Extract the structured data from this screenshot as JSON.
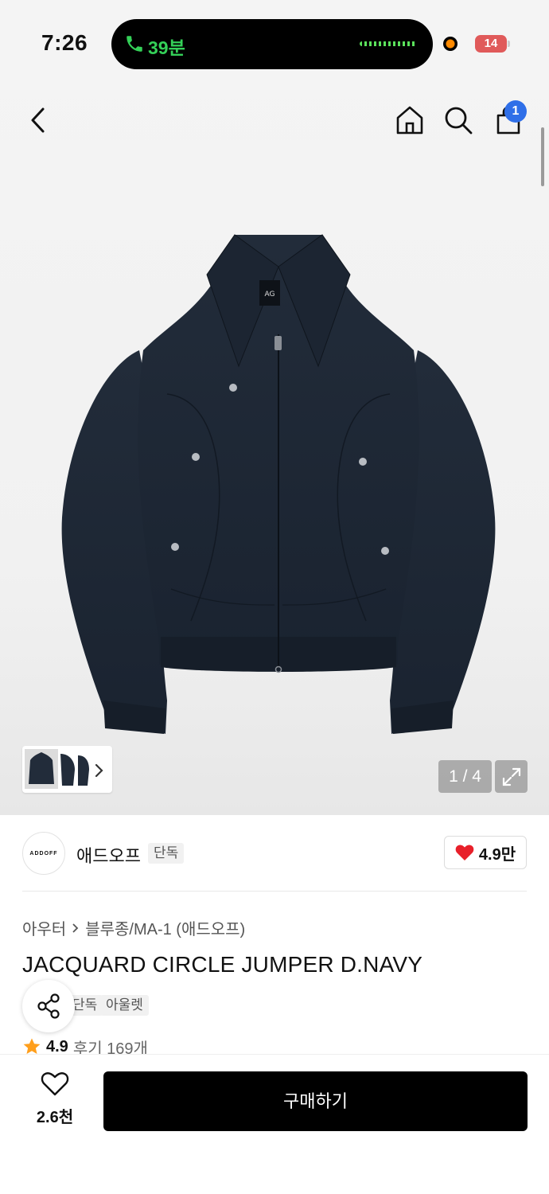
{
  "status_bar": {
    "time": "7:26",
    "call_duration": "39분",
    "battery": "14"
  },
  "nav": {
    "cart_count": "1"
  },
  "gallery": {
    "page_counter": "1 / 4"
  },
  "brand": {
    "logo_text": "ADDOFF",
    "name": "애드오프",
    "exclusive_tag": "단독",
    "likes": "4.9만"
  },
  "breadcrumb": {
    "category": "아우터",
    "subcategory": "블루종/MA-1 (애드오프)"
  },
  "product": {
    "title": "JACQUARD CIRCLE JUMPER D.NAVY",
    "tags": [
      "단독",
      "아울렛"
    ],
    "rating": "4.9",
    "reviews": "후기 169개"
  },
  "bottom_bar": {
    "wish_count": "2.6천",
    "buy_label": "구매하기"
  },
  "colors": {
    "accent_badge": "#2f6fe8",
    "heart": "#e8202a",
    "jacket": "#1e2836",
    "call_green": "#34d058",
    "star": "#ff9f1c"
  }
}
